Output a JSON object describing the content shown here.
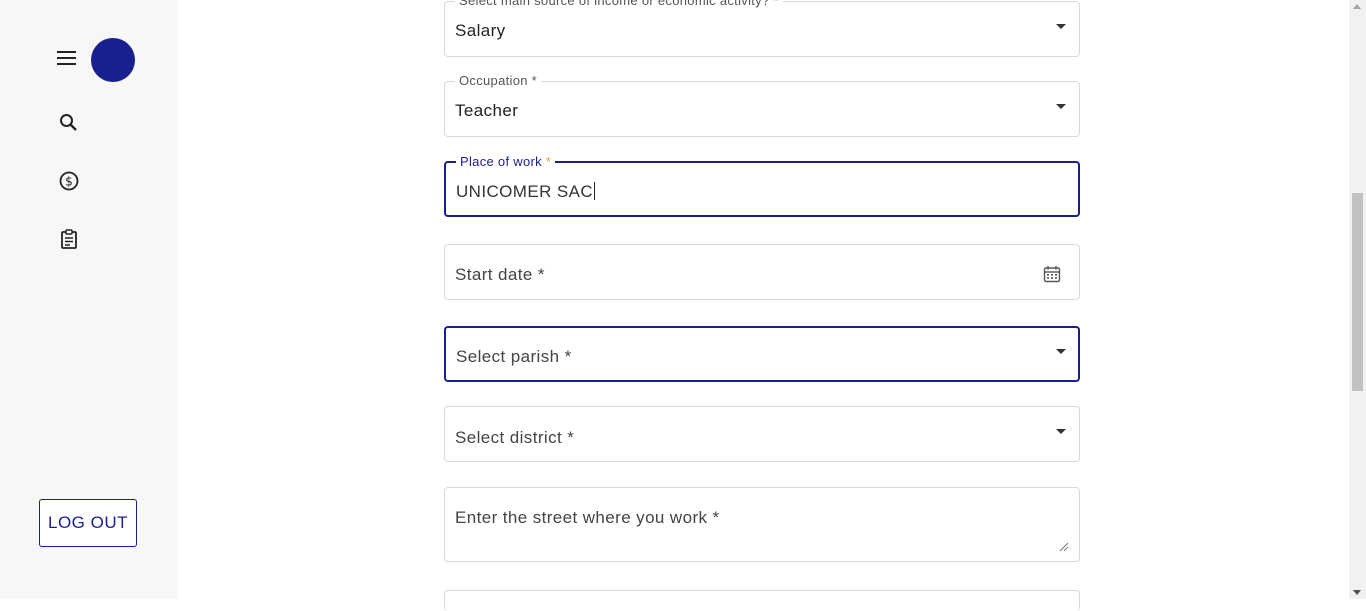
{
  "sidebar": {
    "menu_icon": "hamburger-menu-icon",
    "avatar_color": "#1a1f8f",
    "icons": [
      "search-icon",
      "dollar-circle-icon",
      "clipboard-icon"
    ],
    "logout_label": "LOG OUT"
  },
  "form": {
    "income_source": {
      "label": "Select main source of income or economic activity? *",
      "value": "Salary"
    },
    "occupation": {
      "label": "Occupation *",
      "value": "Teacher"
    },
    "place_of_work": {
      "label": "Place of work",
      "required_mark": "*",
      "value": "UNICOMER SAC"
    },
    "start_date": {
      "placeholder": "Start date *",
      "icon": "calendar-icon"
    },
    "parish": {
      "placeholder": "Select parish *"
    },
    "district": {
      "placeholder": "Select district *"
    },
    "street": {
      "placeholder": "Enter the street where you work *"
    }
  },
  "colors": {
    "accent": "#1a1f8f",
    "required": "#f0a020"
  }
}
